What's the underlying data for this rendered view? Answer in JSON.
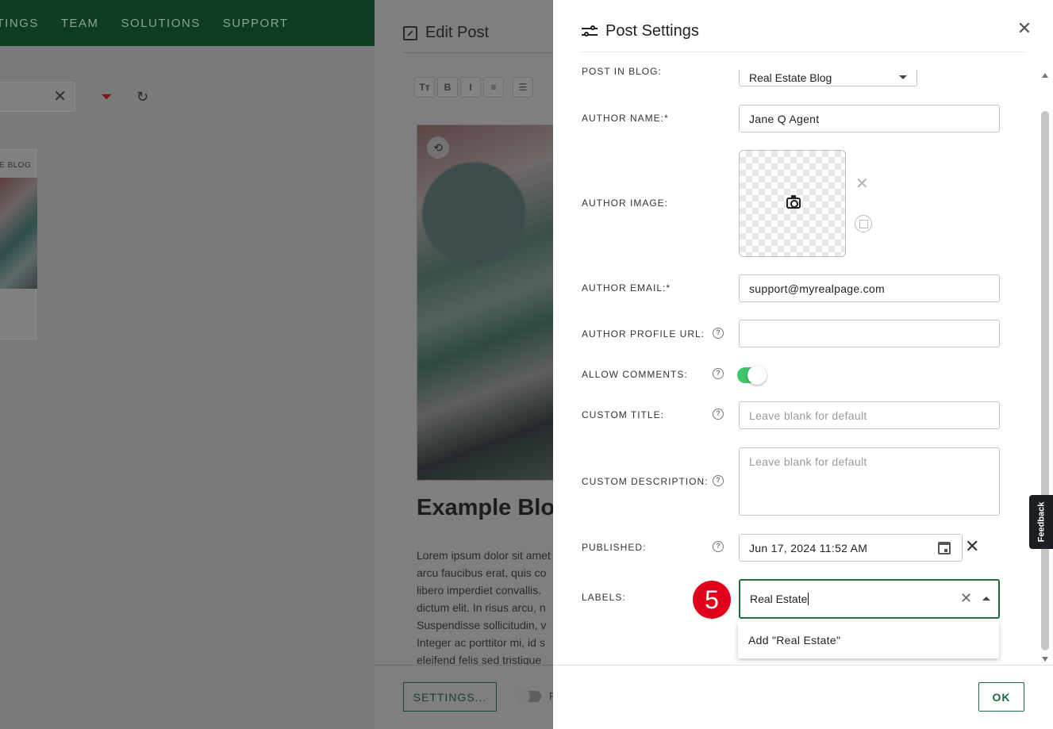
{
  "background": {
    "nav_items": [
      "STINGS",
      "TEAM",
      "SOLUTIONS",
      "SUPPORT"
    ],
    "card_label": "E BLOG"
  },
  "editor": {
    "title": "Edit Post",
    "toolbar": [
      "Tт",
      "B",
      "I",
      "≡",
      "☰"
    ],
    "blog_title": "Example Blog",
    "body_lines": [
      "Lorem ipsum dolor sit amet",
      "arcu faucibus erat, quis co",
      "libero imperdiet convallis.",
      "dictum elit. In risus arcu, n",
      "Suspendisse sollicitudin, v",
      "Integer ac porttitor mi, id s",
      "eleifend felis sed tristique"
    ],
    "settings_button": "SETTINGS...",
    "toggle_label": "F"
  },
  "dialog": {
    "title": "Post Settings",
    "post_in_blog": {
      "label": "POST IN BLOG:",
      "value": "Real Estate Blog"
    },
    "author_name": {
      "label": "AUTHOR NAME:*",
      "value": "Jane Q Agent"
    },
    "author_image": {
      "label": "AUTHOR IMAGE:"
    },
    "author_email": {
      "label": "AUTHOR EMAIL:*",
      "value": "support@myrealpage.com"
    },
    "author_profile_url": {
      "label": "AUTHOR PROFILE URL:",
      "value": ""
    },
    "allow_comments": {
      "label": "ALLOW COMMENTS:",
      "enabled": true
    },
    "custom_title": {
      "label": "CUSTOM TITLE:",
      "placeholder": "Leave blank for default"
    },
    "custom_description": {
      "label": "CUSTOM DESCRIPTION:",
      "placeholder": "Leave blank for default"
    },
    "published": {
      "label": "PUBLISHED:",
      "value": "Jun 17, 2024 11:52 AM"
    },
    "labels": {
      "label": "LABELS:",
      "value": "Real Estate",
      "suggestion": "Add \"Real Estate\""
    },
    "step_number": "5",
    "ok_button": "OK",
    "help_glyph": "?"
  },
  "feedback_tab": "Feedback",
  "colors": {
    "accent": "#1f6b3f",
    "toggle_on": "#3dc66a",
    "badge": "#e0001b"
  }
}
